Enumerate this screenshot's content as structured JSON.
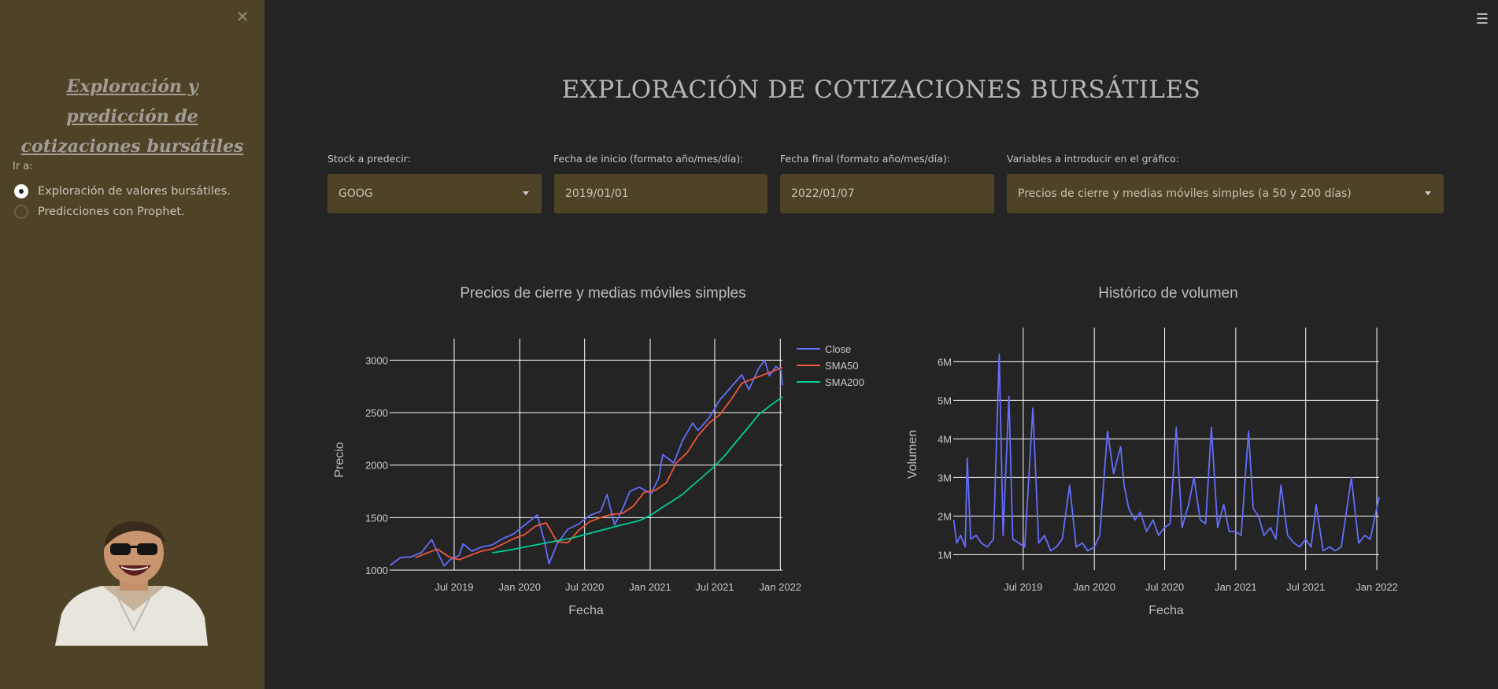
{
  "sidebar": {
    "close_glyph": "✕",
    "title_line1": "Exploración y predicción de",
    "title_line2": "cotizaciones bursátiles",
    "goto_label": "Ir a:",
    "options": [
      {
        "label": "Exploración de valores bursátiles.",
        "selected": true
      },
      {
        "label": "Predicciones con Prophet.",
        "selected": false
      }
    ],
    "avatar_icon": "laughing-man-sunglasses-icon"
  },
  "header": {
    "menu_glyph": "☰"
  },
  "main": {
    "title": "EXPLORACIÓN DE COTIZACIONES BURSÁTILES",
    "fields": {
      "stock": {
        "label": "Stock a predecir:",
        "value": "GOOG"
      },
      "start": {
        "label": "Fecha de inicio (formato año/mes/día):",
        "value": "2019/01/01"
      },
      "end": {
        "label": "Fecha final (formato año/mes/día):",
        "value": "2022/01/07"
      },
      "variables": {
        "label": "Variables a introducir en el gráfico:",
        "value": "Precios de cierre y medias móviles simples (a 50 y 200 días)"
      }
    }
  },
  "colors": {
    "background": "#242424",
    "sidebar": "#4f4327",
    "close": "#636efa",
    "sma50": "#ef553b",
    "sma200": "#00cc96",
    "volume": "#636efa"
  },
  "chart_data": [
    {
      "type": "line",
      "title": "Precios de cierre y medias móviles simples",
      "xlabel": "Fecha",
      "ylabel": "Precio",
      "xlim": [
        "2019-01-01",
        "2022-01-07"
      ],
      "ylim": [
        1000,
        3100
      ],
      "yticks": [
        1000,
        1500,
        2000,
        2500,
        3000
      ],
      "yticklabels": [
        "1000",
        "1500",
        "2000",
        "2500",
        "3000"
      ],
      "xticks": [
        "2019-07-01",
        "2020-01-01",
        "2020-07-01",
        "2021-01-01",
        "2021-07-01",
        "2022-01-01"
      ],
      "xticklabels": [
        "Jul 2019",
        "Jan 2020",
        "Jul 2020",
        "Jan 2021",
        "Jul 2021",
        "Jan 2022"
      ],
      "legend_position": "top-right",
      "grid": true,
      "series": [
        {
          "name": "Close",
          "x": [
            "2019-01-02",
            "2019-02-01",
            "2019-03-01",
            "2019-04-01",
            "2019-04-29",
            "2019-05-15",
            "2019-06-03",
            "2019-06-20",
            "2019-07-15",
            "2019-07-26",
            "2019-08-20",
            "2019-09-15",
            "2019-10-15",
            "2019-11-15",
            "2019-12-15",
            "2020-01-15",
            "2020-02-19",
            "2020-03-10",
            "2020-03-23",
            "2020-04-15",
            "2020-05-15",
            "2020-06-15",
            "2020-07-15",
            "2020-08-15",
            "2020-09-02",
            "2020-09-23",
            "2020-10-15",
            "2020-11-05",
            "2020-12-01",
            "2021-01-04",
            "2021-01-25",
            "2021-02-05",
            "2021-02-25",
            "2021-03-08",
            "2021-04-01",
            "2021-04-30",
            "2021-05-15",
            "2021-06-15",
            "2021-07-15",
            "2021-08-15",
            "2021-09-15",
            "2021-10-05",
            "2021-11-01",
            "2021-11-18",
            "2021-12-01",
            "2021-12-20",
            "2022-01-03",
            "2022-01-07"
          ],
          "y": [
            1045,
            1120,
            1125,
            1170,
            1290,
            1170,
            1040,
            1100,
            1140,
            1250,
            1180,
            1220,
            1240,
            1300,
            1345,
            1430,
            1525,
            1280,
            1060,
            1250,
            1390,
            1440,
            1520,
            1560,
            1720,
            1430,
            1580,
            1750,
            1790,
            1730,
            1880,
            2100,
            2050,
            2020,
            2230,
            2400,
            2330,
            2450,
            2620,
            2740,
            2860,
            2720,
            2920,
            3000,
            2850,
            2940,
            2900,
            2760
          ]
        },
        {
          "name": "SMA50",
          "x": [
            "2019-03-14",
            "2019-05-15",
            "2019-06-15",
            "2019-07-15",
            "2019-08-15",
            "2019-09-15",
            "2019-10-15",
            "2019-11-15",
            "2019-12-15",
            "2020-01-15",
            "2020-02-15",
            "2020-03-15",
            "2020-04-15",
            "2020-05-15",
            "2020-06-15",
            "2020-07-15",
            "2020-08-15",
            "2020-09-15",
            "2020-10-15",
            "2020-11-15",
            "2020-12-15",
            "2021-01-15",
            "2021-02-15",
            "2021-03-15",
            "2021-04-15",
            "2021-05-15",
            "2021-06-15",
            "2021-07-15",
            "2021-08-15",
            "2021-09-15",
            "2021-10-15",
            "2021-11-15",
            "2021-12-15",
            "2022-01-07"
          ],
          "y": [
            1120,
            1200,
            1130,
            1100,
            1140,
            1180,
            1200,
            1250,
            1300,
            1340,
            1420,
            1450,
            1270,
            1260,
            1380,
            1460,
            1500,
            1530,
            1540,
            1610,
            1740,
            1760,
            1830,
            2020,
            2120,
            2280,
            2400,
            2480,
            2620,
            2780,
            2820,
            2860,
            2900,
            2930
          ]
        },
        {
          "name": "SMA200",
          "x": [
            "2019-10-16",
            "2019-12-01",
            "2020-02-01",
            "2020-04-01",
            "2020-06-01",
            "2020-08-01",
            "2020-10-01",
            "2020-12-01",
            "2021-01-01",
            "2021-02-01",
            "2021-03-01",
            "2021-04-01",
            "2021-05-01",
            "2021-06-01",
            "2021-07-01",
            "2021-08-01",
            "2021-09-01",
            "2021-10-01",
            "2021-11-01",
            "2021-12-01",
            "2022-01-07"
          ],
          "y": [
            1165,
            1190,
            1230,
            1270,
            1310,
            1365,
            1420,
            1470,
            1520,
            1590,
            1650,
            1720,
            1810,
            1900,
            1990,
            2100,
            2230,
            2350,
            2480,
            2560,
            2650
          ]
        }
      ]
    },
    {
      "type": "line",
      "title": "Histórico de volumen",
      "xlabel": "Fecha",
      "ylabel": "Volumen",
      "xlim": [
        "2019-01-01",
        "2022-01-07"
      ],
      "ylim": [
        600000,
        6600000
      ],
      "yticks": [
        1000000,
        2000000,
        3000000,
        4000000,
        5000000,
        6000000
      ],
      "yticklabels": [
        "1M",
        "2M",
        "3M",
        "4M",
        "5M",
        "6M"
      ],
      "xticks": [
        "2019-07-01",
        "2020-01-01",
        "2020-07-01",
        "2021-01-01",
        "2021-07-01",
        "2022-01-01"
      ],
      "xticklabels": [
        "Jul 2019",
        "Jan 2020",
        "Jul 2020",
        "Jan 2021",
        "Jul 2021",
        "Jan 2022"
      ],
      "grid": true,
      "series": [
        {
          "name": "Volume",
          "x": [
            "2019-01-02",
            "2019-01-10",
            "2019-01-20",
            "2019-02-01",
            "2019-02-06",
            "2019-02-15",
            "2019-03-01",
            "2019-03-15",
            "2019-03-30",
            "2019-04-15",
            "2019-04-30",
            "2019-05-10",
            "2019-05-25",
            "2019-06-04",
            "2019-06-20",
            "2019-07-05",
            "2019-07-26",
            "2019-08-10",
            "2019-08-25",
            "2019-09-10",
            "2019-09-25",
            "2019-10-10",
            "2019-10-29",
            "2019-11-15",
            "2019-12-01",
            "2019-12-15",
            "2020-01-01",
            "2020-01-15",
            "2020-02-04",
            "2020-02-20",
            "2020-03-09",
            "2020-03-18",
            "2020-03-30",
            "2020-04-15",
            "2020-04-29",
            "2020-05-15",
            "2020-06-01",
            "2020-06-15",
            "2020-07-01",
            "2020-07-15",
            "2020-07-31",
            "2020-08-15",
            "2020-09-01",
            "2020-09-15",
            "2020-10-01",
            "2020-10-15",
            "2020-10-30",
            "2020-11-15",
            "2020-12-01",
            "2020-12-15",
            "2021-01-01",
            "2021-01-15",
            "2021-02-03",
            "2021-02-15",
            "2021-03-01",
            "2021-03-15",
            "2021-04-01",
            "2021-04-15",
            "2021-04-28",
            "2021-05-15",
            "2021-06-01",
            "2021-06-15",
            "2021-07-01",
            "2021-07-15",
            "2021-07-28",
            "2021-08-15",
            "2021-09-01",
            "2021-09-15",
            "2021-10-01",
            "2021-10-27",
            "2021-11-15",
            "2021-12-01",
            "2021-12-15",
            "2022-01-07"
          ],
          "y": [
            1900000,
            1300000,
            1500000,
            1200000,
            3500000,
            1400000,
            1500000,
            1300000,
            1200000,
            1400000,
            6200000,
            1500000,
            5100000,
            1400000,
            1300000,
            1200000,
            4800000,
            1300000,
            1500000,
            1100000,
            1200000,
            1400000,
            2800000,
            1200000,
            1300000,
            1100000,
            1200000,
            1500000,
            4200000,
            3100000,
            3800000,
            2800000,
            2200000,
            1900000,
            2100000,
            1600000,
            1900000,
            1500000,
            1700000,
            1800000,
            4300000,
            1700000,
            2300000,
            3000000,
            1900000,
            1800000,
            4300000,
            1700000,
            2300000,
            1600000,
            1600000,
            1500000,
            4200000,
            2200000,
            2000000,
            1500000,
            1700000,
            1400000,
            2800000,
            1500000,
            1300000,
            1200000,
            1400000,
            1200000,
            2300000,
            1100000,
            1200000,
            1100000,
            1200000,
            3000000,
            1300000,
            1500000,
            1400000,
            2500000
          ]
        }
      ]
    }
  ]
}
